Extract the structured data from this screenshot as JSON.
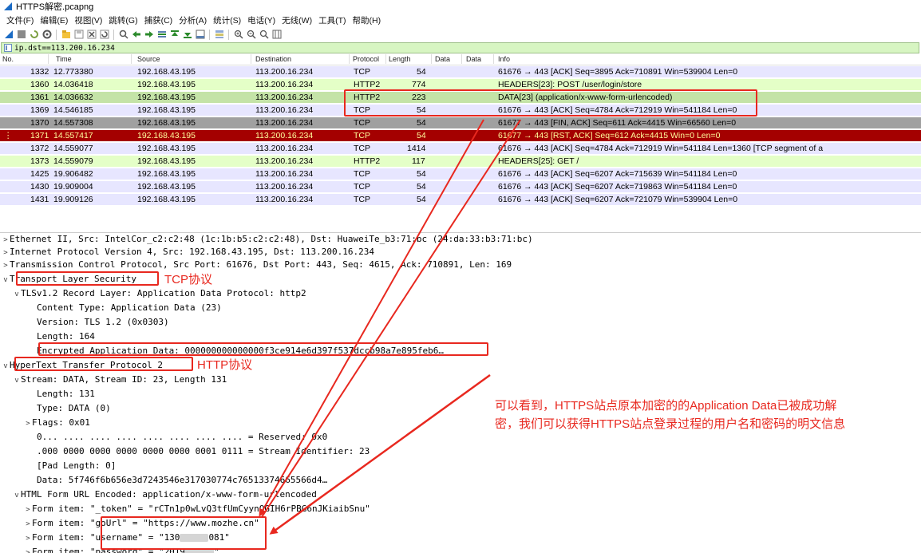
{
  "window": {
    "title": "HTTPS解密.pcapng"
  },
  "menu": [
    "文件(F)",
    "编辑(E)",
    "视图(V)",
    "跳转(G)",
    "捕获(C)",
    "分析(A)",
    "统计(S)",
    "电话(Y)",
    "无线(W)",
    "工具(T)",
    "帮助(H)"
  ],
  "filter": {
    "value": "ip.dst==113.200.16.234"
  },
  "columns": [
    "No.",
    "Time",
    "Source",
    "Destination",
    "Protocol",
    "Length",
    "Data",
    "Data",
    "Info"
  ],
  "packets": [
    {
      "no": "1332",
      "time": "12.773380",
      "src": "192.168.43.195",
      "dst": "113.200.16.234",
      "proto": "TCP",
      "len": "54",
      "info": "61676 → 443 [ACK] Seq=3895 Ack=710891 Win=539904 Len=0"
    },
    {
      "no": "1360",
      "time": "14.036418",
      "src": "192.168.43.195",
      "dst": "113.200.16.234",
      "proto": "HTTP2",
      "len": "774",
      "info": "HEADERS[23]: POST /user/login/store"
    },
    {
      "no": "1361",
      "time": "14.036632",
      "src": "192.168.43.195",
      "dst": "113.200.16.234",
      "proto": "HTTP2",
      "len": "223",
      "info": "DATA[23] (application/x-www-form-urlencoded)"
    },
    {
      "no": "1369",
      "time": "14.546185",
      "src": "192.168.43.195",
      "dst": "113.200.16.234",
      "proto": "TCP",
      "len": "54",
      "info": "61676 → 443 [ACK] Seq=4784 Ack=712919 Win=541184 Len=0"
    },
    {
      "no": "1370",
      "time": "14.557308",
      "src": "192.168.43.195",
      "dst": "113.200.16.234",
      "proto": "TCP",
      "len": "54",
      "info": "61677 → 443 [FIN, ACK] Seq=611 Ack=4415 Win=66560 Len=0"
    },
    {
      "no": "1371",
      "time": "14.557417",
      "src": "192.168.43.195",
      "dst": "113.200.16.234",
      "proto": "TCP",
      "len": "54",
      "info": "61677 → 443 [RST, ACK] Seq=612 Ack=4415 Win=0 Len=0"
    },
    {
      "no": "1372",
      "time": "14.559077",
      "src": "192.168.43.195",
      "dst": "113.200.16.234",
      "proto": "TCP",
      "len": "1414",
      "info": "61676 → 443 [ACK] Seq=4784 Ack=712919 Win=541184 Len=1360 [TCP segment of a"
    },
    {
      "no": "1373",
      "time": "14.559079",
      "src": "192.168.43.195",
      "dst": "113.200.16.234",
      "proto": "HTTP2",
      "len": "117",
      "info": "HEADERS[25]: GET /"
    },
    {
      "no": "1425",
      "time": "19.906482",
      "src": "192.168.43.195",
      "dst": "113.200.16.234",
      "proto": "TCP",
      "len": "54",
      "info": "61676 → 443 [ACK] Seq=6207 Ack=715639 Win=541184 Len=0"
    },
    {
      "no": "1430",
      "time": "19.909004",
      "src": "192.168.43.195",
      "dst": "113.200.16.234",
      "proto": "TCP",
      "len": "54",
      "info": "61676 → 443 [ACK] Seq=6207 Ack=719863 Win=541184 Len=0"
    },
    {
      "no": "1431",
      "time": "19.909126",
      "src": "192.168.43.195",
      "dst": "113.200.16.234",
      "proto": "TCP",
      "len": "54",
      "info": "61676 → 443 [ACK] Seq=6207 Ack=721079 Win=539904 Len=0"
    }
  ],
  "row_colors": {
    "tcp": "#e7e6ff",
    "http2": "#e4ffc7",
    "http2_selected": "#c4e3a7",
    "gray": "#a0a0a0",
    "rst": "#a40000",
    "rst_text": "#fffc9c"
  },
  "details": [
    {
      "tw": ">",
      "text": "Ethernet II, Src: IntelCor_c2:c2:48 (1c:1b:b5:c2:c2:48), Dst: HuaweiTe_b3:71:bc (24:da:33:b3:71:bc)"
    },
    {
      "tw": ">",
      "text": "Internet Protocol Version 4, Src: 192.168.43.195, Dst: 113.200.16.234"
    },
    {
      "tw": ">",
      "text": "Transmission Control Protocol, Src Port: 61676, Dst Port: 443, Seq: 4615, Ack: 710891, Len: 169"
    },
    {
      "tw": "v",
      "text": "Transport Layer Security"
    },
    {
      "tw": "v",
      "text": "TLSv1.2 Record Layer: Application Data Protocol: http2"
    },
    {
      "tw": "",
      "text": "Content Type: Application Data (23)"
    },
    {
      "tw": "",
      "text": "Version: TLS 1.2 (0x0303)"
    },
    {
      "tw": "",
      "text": "Length: 164"
    },
    {
      "tw": "",
      "text": "Encrypted Application Data: 000000000000000f3ce914e6d397f537dccb98a7e895feb6…"
    },
    {
      "tw": "v",
      "text": "HyperText Transfer Protocol 2"
    },
    {
      "tw": "v",
      "text": "Stream: DATA, Stream ID: 23, Length 131"
    },
    {
      "tw": "",
      "text": "Length: 131"
    },
    {
      "tw": "",
      "text": "Type: DATA (0)"
    },
    {
      "tw": ">",
      "text": "Flags: 0x01"
    },
    {
      "tw": "",
      "text": "0... .... .... .... .... .... .... .... = Reserved: 0x0"
    },
    {
      "tw": "",
      "text": ".000 0000 0000 0000 0000 0000 0001 0111 = Stream Identifier: 23"
    },
    {
      "tw": "",
      "text": "[Pad Length: 0]"
    },
    {
      "tw": "",
      "text": "Data: 5f746f6b656e3d7243546e317030774c76513374665566d4…"
    },
    {
      "tw": "v",
      "text": "HTML Form URL Encoded: application/x-www-form-urlencoded"
    },
    {
      "tw": ">",
      "text": "Form item: \"_token\" = \"rCTn1p0wLvQ3tfUmCyynQGIH6rPBG6nJKiaibSnu\""
    },
    {
      "tw": ">",
      "text": "Form item: \"goUrl\" = \"https://www.mozhe.cn\""
    },
    {
      "tw": ">",
      "text": "Form item: \"username\" = \"130"
    },
    {
      "tw": ">",
      "text": "Form item: \"password\" = \"2019"
    }
  ],
  "masked": {
    "username_tail": "081\"",
    "password_tail": "\""
  },
  "annotations": {
    "tcp_label": "TCP协议",
    "http_label": "HTTP协议",
    "note_line1": "可以看到，HTTPS站点原本加密的的Application Data已被成功解",
    "note_line2": "密，我们可以获得HTTPS站点登录过程的用户名和密码的明文信息",
    "color": "#e8281f"
  }
}
